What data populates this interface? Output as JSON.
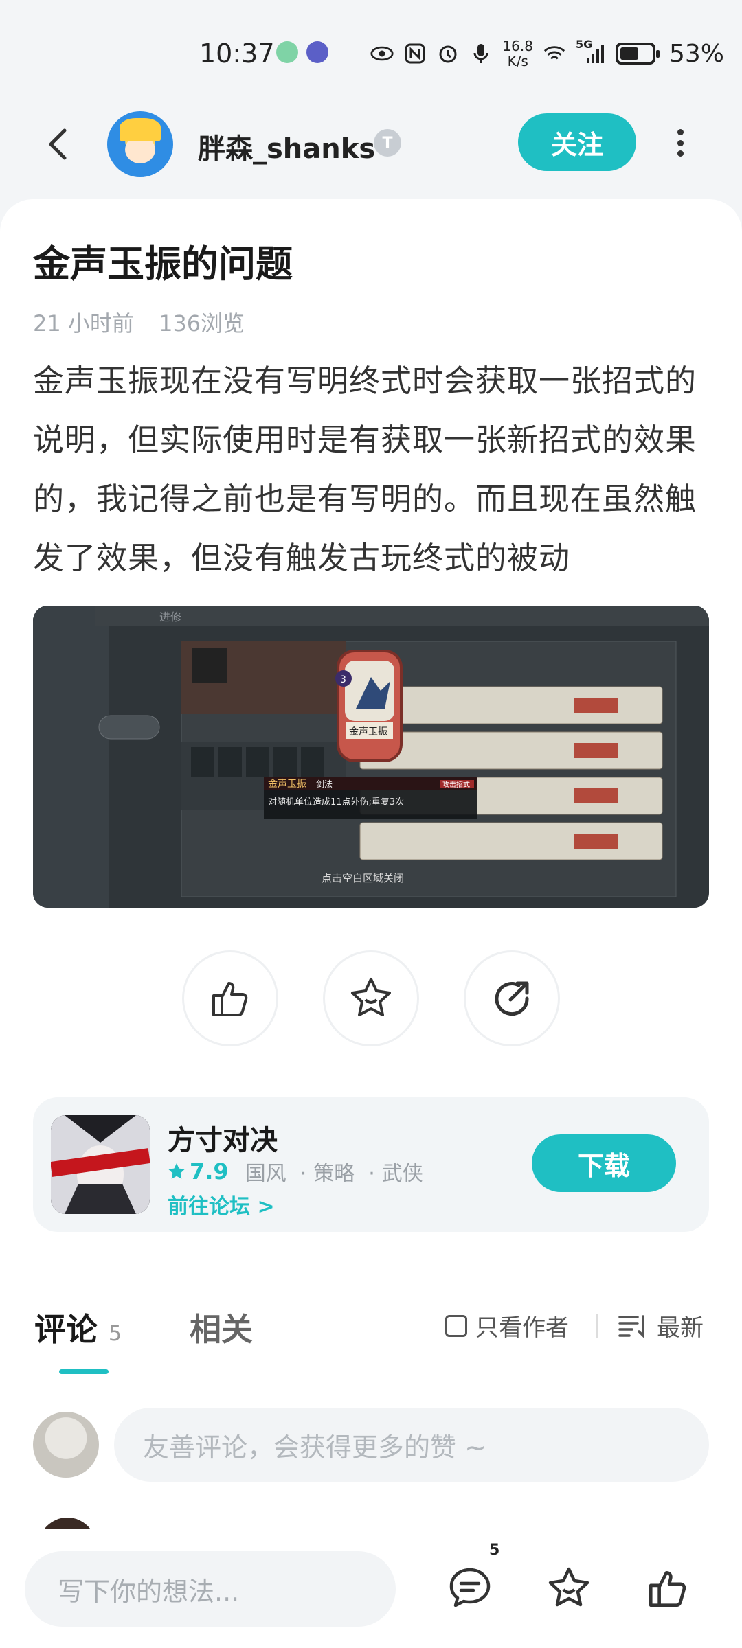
{
  "status_bar": {
    "time": "10:37",
    "net_speed_value": "16.8",
    "net_speed_unit": "K/s",
    "network_type": "5G",
    "battery": "53%"
  },
  "header": {
    "username": "胖森_shanks",
    "level_badge": "T",
    "follow_label": "关注"
  },
  "post": {
    "title": "金声玉振的问题",
    "time_ago": "21 小时前",
    "views": "136浏览",
    "body": "金声玉振现在没有写明终式时会获取一张招式的说明，但实际使用时是有获取一张新招式的效果的，我记得之前也是有写明的。而且现在虽然触发了效果，但没有触发古玩终式的被动",
    "image": {
      "card_name": "金声玉振",
      "card_cost": "3",
      "popup_title": "金声玉振",
      "popup_tag": "剑法",
      "popup_type": "攻击招式",
      "popup_text": "对随机单位造成11点外伤;重复3次",
      "close_hint": "点击空白区域关闭",
      "tab_label": "进修"
    }
  },
  "game": {
    "name": "方寸对决",
    "rating": "7.9",
    "tags": [
      "国风",
      "策略",
      "武侠"
    ],
    "tag_separator": "·",
    "forum_link": "前往论坛 >",
    "download_label": "下载"
  },
  "comments": {
    "tab_comments": "评论",
    "count": "5",
    "tab_related": "相关",
    "only_author": "只看作者",
    "sort_label": "最新",
    "input_placeholder": "友善评论，会获得更多的赞 ~"
  },
  "bottom_bar": {
    "input_placeholder": "写下你的想法...",
    "comment_badge": "5"
  },
  "colors": {
    "accent": "#1fbfc3",
    "text_primary": "#1a1a1a",
    "text_muted": "#a3a8ae"
  }
}
